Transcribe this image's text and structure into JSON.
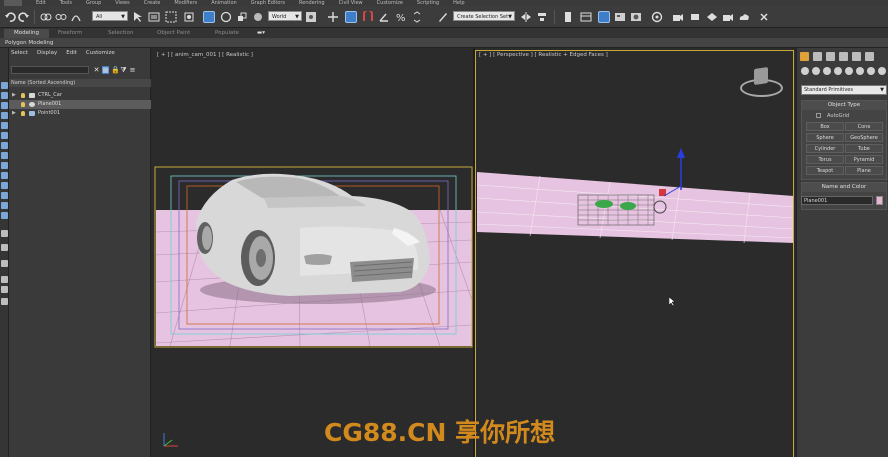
{
  "menu": {
    "items": [
      "Edit",
      "Tools",
      "Group",
      "Views",
      "Create",
      "Modifiers",
      "Animation",
      "Graph Editors",
      "Rendering",
      "Civil View",
      "Customize",
      "Scripting",
      "Help"
    ]
  },
  "toolbar": {
    "selection_filter": "All",
    "reference_coord": "World",
    "named_selection": "Create Selection Set"
  },
  "ribbon": {
    "tabs": [
      "Modeling",
      "Freeform",
      "Selection",
      "Object Paint",
      "Populate"
    ],
    "active_tab": "Modeling",
    "panel": "Polygon Modeling"
  },
  "explorer": {
    "menu": [
      "Select",
      "Display",
      "Edit",
      "Customize"
    ],
    "column_header": "Name (Sorted Ascending)",
    "rows": [
      {
        "name": "CTRL_Car",
        "selected": false
      },
      {
        "name": "Plane001",
        "selected": true
      },
      {
        "name": "Point001",
        "selected": false
      }
    ]
  },
  "viewports": {
    "left_label": "[ + ] [ anim_cam_001 ] [ Realistic ]",
    "right_label": "[ + ] [ Perspective ] [ Realistic + Edged Faces ]"
  },
  "command_panel": {
    "category": "Standard Primitives",
    "object_type_title": "Object Type",
    "autogrid_label": "AutoGrid",
    "primitives": [
      "Box",
      "Cone",
      "Sphere",
      "GeoSphere",
      "Cylinder",
      "Tube",
      "Torus",
      "Pyramid",
      "Teapot",
      "Plane"
    ],
    "name_color_title": "Name and Color",
    "object_name": "Plane001",
    "object_color": "#e8b4d4"
  },
  "watermark": "CG88.CN 享你所想",
  "colors": {
    "ground_plane": "#e6c3e0",
    "grid_lines": "#b98fb5",
    "viewport_frame": "#c9a93c",
    "accent_blue": "#3f7ec9"
  }
}
